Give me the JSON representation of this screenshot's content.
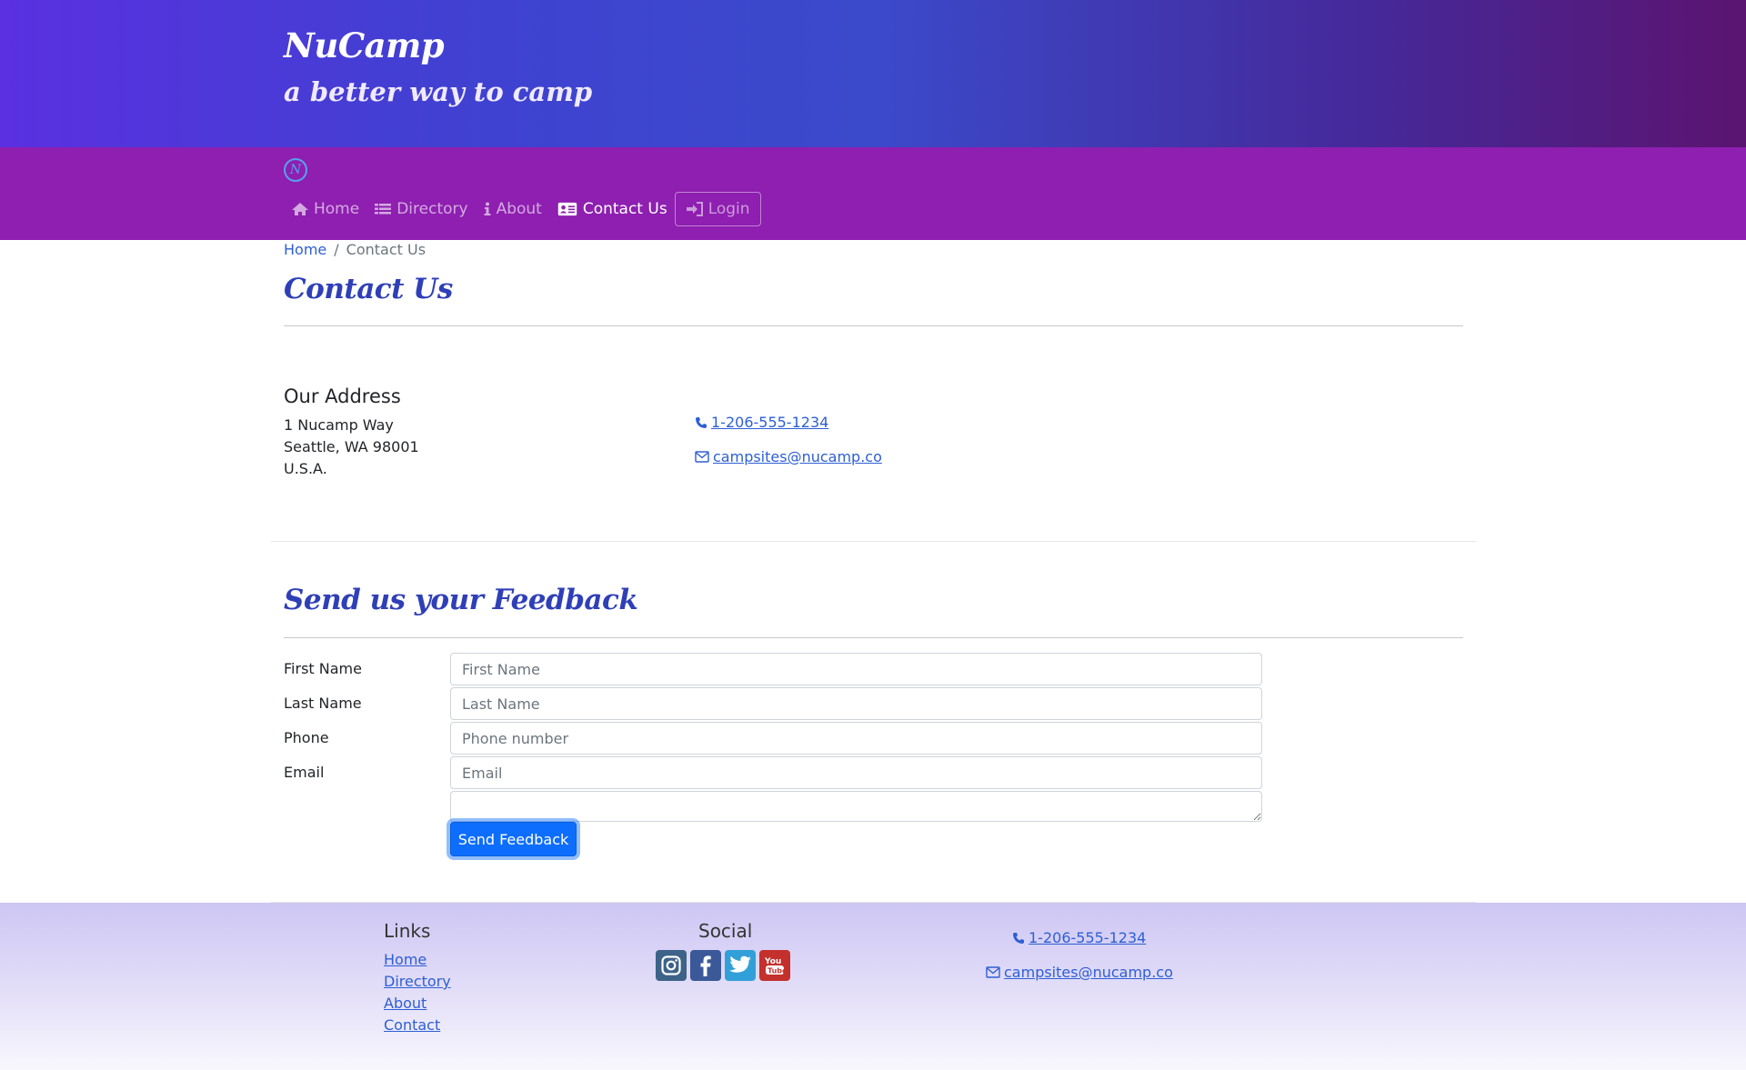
{
  "header": {
    "title": "NuCamp",
    "subtitle": "a better way to camp"
  },
  "nav": {
    "items": [
      {
        "label": "Home",
        "icon": "home-icon"
      },
      {
        "label": "Directory",
        "icon": "list-icon"
      },
      {
        "label": "About",
        "icon": "info-icon"
      },
      {
        "label": "Contact Us",
        "icon": "address-card-icon",
        "active": true
      }
    ],
    "login": "Login"
  },
  "breadcrumb": {
    "home": "Home",
    "separator": "/",
    "current": "Contact Us"
  },
  "page_title": "Contact Us",
  "address": {
    "heading": "Our Address",
    "line1": "1 Nucamp Way",
    "line2": "Seattle, WA 98001",
    "line3": "U.S.A."
  },
  "contact": {
    "phone": "1-206-555-1234",
    "email": "campsites@nucamp.co"
  },
  "feedback": {
    "title": "Send us your Feedback",
    "first_name_label": "First Name",
    "first_name_placeholder": "First Name",
    "last_name_label": "Last Name",
    "last_name_placeholder": "Last Name",
    "phone_label": "Phone",
    "phone_placeholder": "Phone number",
    "email_label": "Email",
    "email_placeholder": "Email",
    "submit": "Send Feedback"
  },
  "footer": {
    "links_heading": "Links",
    "links": [
      "Home",
      "Directory",
      "About",
      "Contact"
    ],
    "social_heading": "Social",
    "social": [
      "instagram-icon",
      "facebook-icon",
      "twitter-icon",
      "youtube-icon"
    ],
    "phone": "1-206-555-1234",
    "email": "campsites@nucamp.co"
  },
  "colors": {
    "brand_title": "#2f3fb8",
    "navbar": "#8e1fb0",
    "link": "#2d5fd4",
    "button": "#0d6efd"
  }
}
